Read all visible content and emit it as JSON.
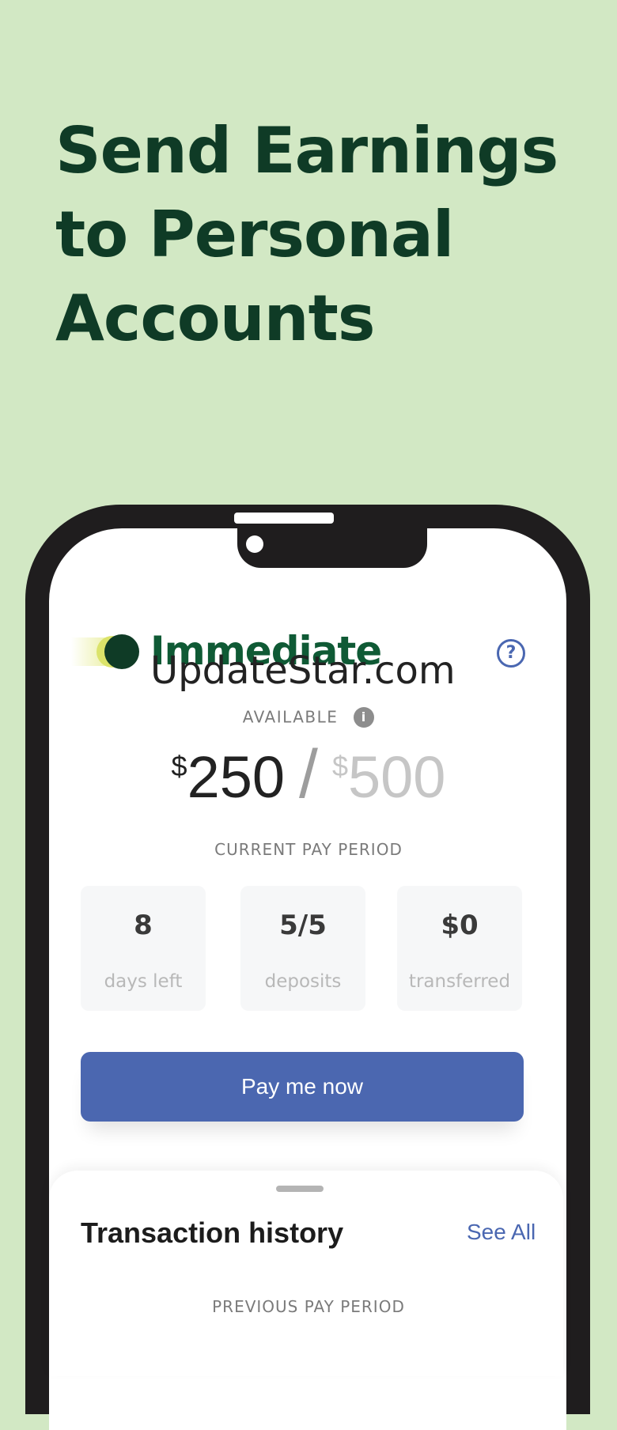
{
  "headline": {
    "line1": "Send Earnings",
    "line2": "to Personal",
    "line3": "Accounts"
  },
  "app": {
    "brand_name": "Immediate",
    "help_glyph": "?",
    "watermark": "UpdateStar.com"
  },
  "balance": {
    "available_label": "AVAILABLE",
    "info_glyph": "i",
    "currency": "$",
    "available_amount": "250",
    "separator": "/",
    "limit_amount": "500"
  },
  "pay_period": {
    "label": "CURRENT PAY PERIOD",
    "stats": [
      {
        "value": "8",
        "label": "days left"
      },
      {
        "value": "5/5",
        "label": "deposits"
      },
      {
        "value": "$0",
        "label": "transferred"
      }
    ]
  },
  "actions": {
    "pay_button": "Pay me now"
  },
  "transactions": {
    "title": "Transaction history",
    "see_all": "See All",
    "section_label": "PREVIOUS PAY PERIOD"
  },
  "colors": {
    "background": "#d2e8c4",
    "headline": "#0f3b26",
    "brand": "#0f5a35",
    "accent": "#4b67b0"
  },
  "icons": {
    "help": "question-circle-icon",
    "info": "info-icon",
    "logo": "toggle-logo-icon"
  }
}
